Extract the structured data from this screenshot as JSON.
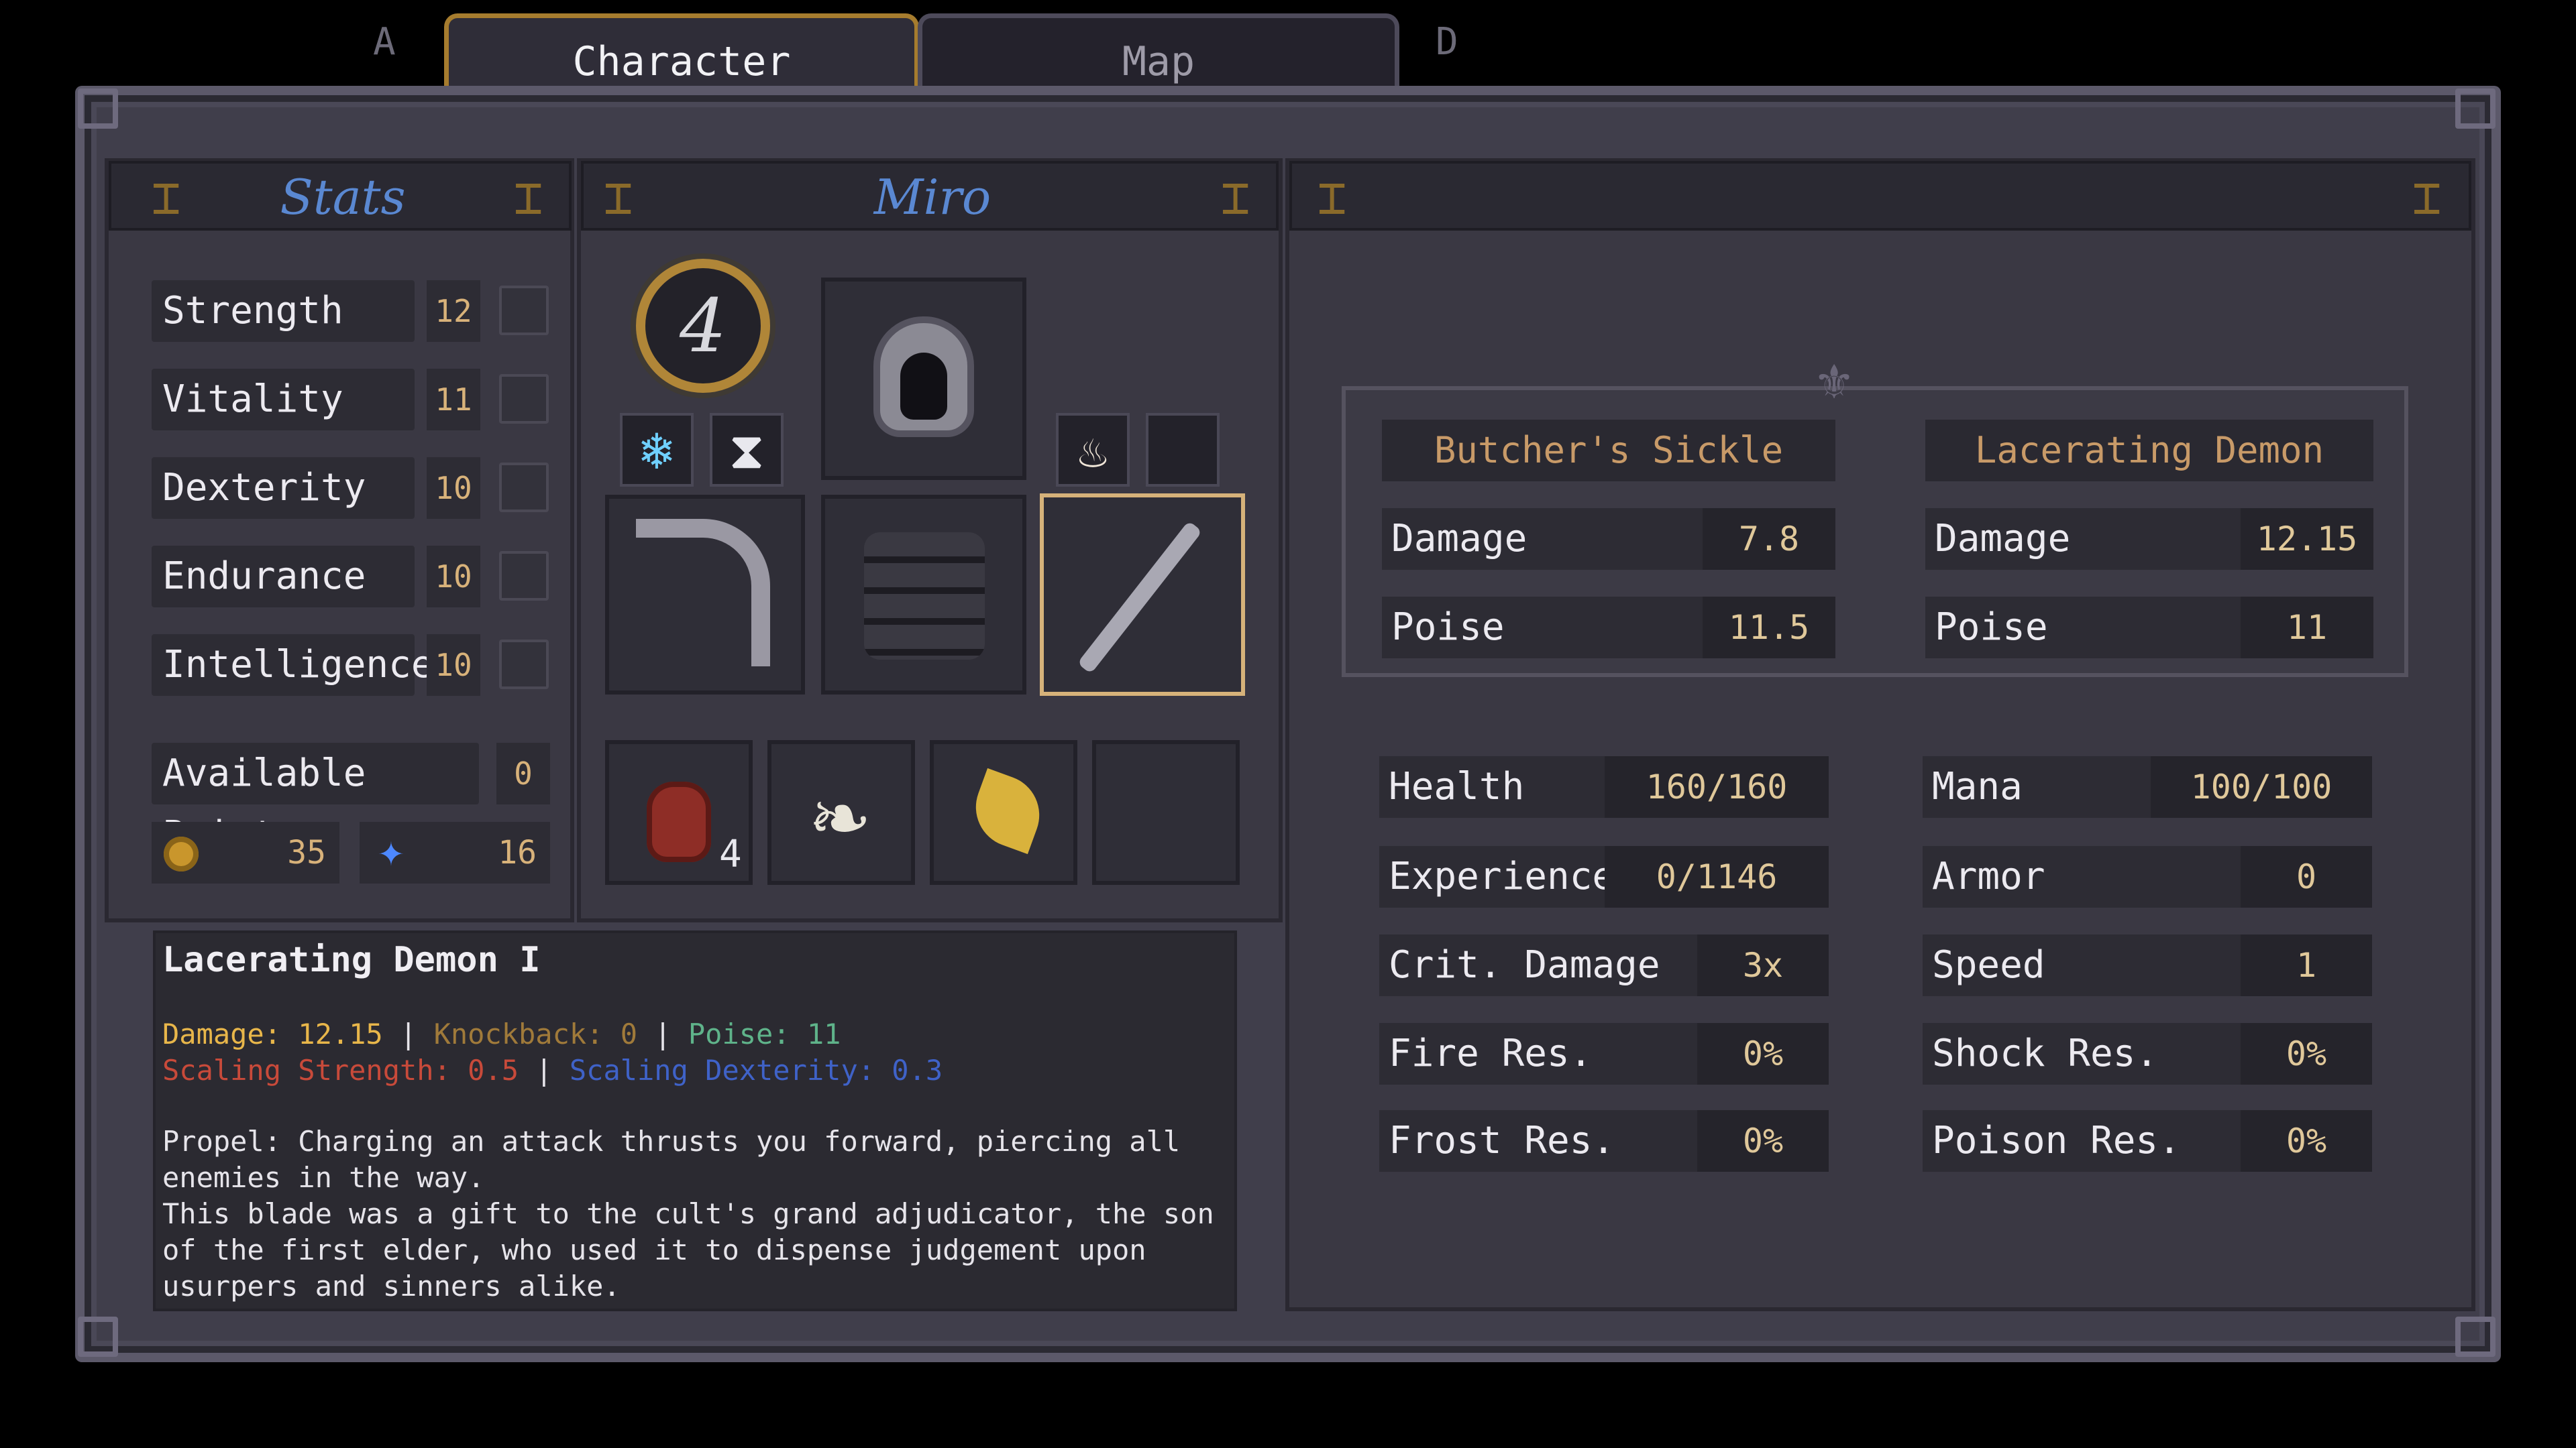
{
  "tabs": {
    "left_key": "A",
    "right_key": "D",
    "items": [
      {
        "label": "Character",
        "active": true
      },
      {
        "label": "Map",
        "active": false
      }
    ]
  },
  "stats_panel": {
    "title": "Stats",
    "stats": [
      {
        "label": "Strength",
        "value": "12"
      },
      {
        "label": "Vitality",
        "value": "11"
      },
      {
        "label": "Dexterity",
        "value": "10"
      },
      {
        "label": "Endurance",
        "value": "10"
      },
      {
        "label": "Intelligence",
        "value": "10"
      }
    ],
    "available_points_label": "Available Points",
    "available_points": "0",
    "gold": "35",
    "souls": "16"
  },
  "character_panel": {
    "name": "Miro",
    "level": "4",
    "consumable_count": "4"
  },
  "description": {
    "title": "Lacerating Demon I",
    "stats_line_1": {
      "damage": "Damage: 12.15",
      "sep1": " | ",
      "knockback": "Knockback: 0",
      "sep2": " | ",
      "poise": "Poise: 11"
    },
    "stats_line_2": {
      "scaling_str": "Scaling Strength: 0.5",
      "sep": " | ",
      "scaling_dex": "Scaling Dexterity: 0.3"
    },
    "body_1": "Propel: Charging an attack thrusts you forward, piercing all enemies in the way.",
    "body_2": "This blade was a gift to the cult's grand adjudicator, the son of the first elder, who used it to dispense judgement upon usurpers and sinners alike."
  },
  "comparison": {
    "left": {
      "name": "Butcher's Sickle",
      "rows": [
        {
          "label": "Damage",
          "value": "7.8"
        },
        {
          "label": "Poise",
          "value": "11.5"
        }
      ]
    },
    "right": {
      "name": "Lacerating Demon",
      "rows": [
        {
          "label": "Damage",
          "value": "12.15"
        },
        {
          "label": "Poise",
          "value": "11"
        }
      ]
    }
  },
  "attributes": {
    "left": [
      {
        "label": "Health",
        "value": "160/160"
      },
      {
        "label": "Experience",
        "value": "0/1146"
      },
      {
        "label": "Crit. Damage",
        "value": "3x"
      },
      {
        "label": "Fire Res.",
        "value": "0%"
      },
      {
        "label": "Frost Res.",
        "value": "0%"
      }
    ],
    "right": [
      {
        "label": "Mana",
        "value": "100/100"
      },
      {
        "label": "Armor",
        "value": "0"
      },
      {
        "label": "Speed",
        "value": "1"
      },
      {
        "label": "Shock Res.",
        "value": "0%"
      },
      {
        "label": "Poison Res.",
        "value": "0%"
      }
    ]
  },
  "colors": {
    "damage": "#e8b64a",
    "knockback": "#a07a3a",
    "poise": "#5fb38a",
    "scaling_strength": "#c84a3a",
    "scaling_dexterity": "#3f62c8",
    "tab_active_border": "#a67c2e"
  },
  "icons": [
    "gold-coin-icon",
    "soul-orb-icon",
    "frost-buff-icon",
    "hourglass-buff-icon",
    "flame-relic-icon",
    "hood-armor-icon",
    "sickle-weapon-icon",
    "chest-armor-icon",
    "sword-weapon-icon",
    "potion-icon",
    "feather-icon",
    "leaf-icon"
  ]
}
